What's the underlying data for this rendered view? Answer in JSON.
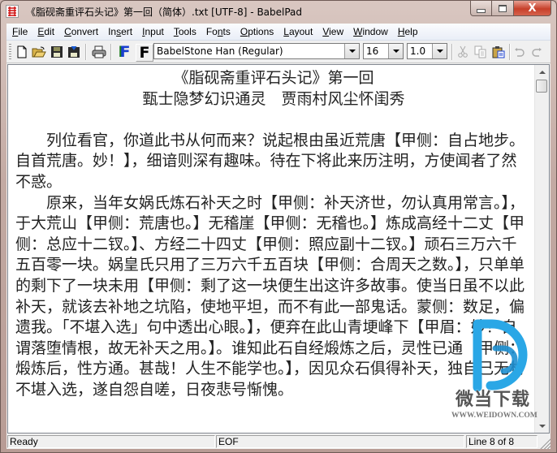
{
  "window": {
    "title": "《脂砚斋重评石头记》第一回（简体）.txt [UTF-8] - BabelPad",
    "app_icon": "babelpad-icon",
    "controls": {
      "minimize_glyph": "–",
      "maximize_glyph": "□",
      "close_glyph": "X"
    }
  },
  "menubar": {
    "items": [
      {
        "label": "File",
        "mnemonic": "F"
      },
      {
        "label": "Edit",
        "mnemonic": "E"
      },
      {
        "label": "Convert",
        "mnemonic": "C"
      },
      {
        "label": "Insert",
        "mnemonic": "s"
      },
      {
        "label": "Input",
        "mnemonic": "I"
      },
      {
        "label": "Tools",
        "mnemonic": "T"
      },
      {
        "label": "Fonts",
        "mnemonic": "n"
      },
      {
        "label": "Options",
        "mnemonic": "O"
      },
      {
        "label": "Layout",
        "mnemonic": "L"
      },
      {
        "label": "View",
        "mnemonic": "V"
      },
      {
        "label": "Window",
        "mnemonic": "W"
      },
      {
        "label": "Help",
        "mnemonic": "H"
      }
    ]
  },
  "toolbar": {
    "buttons": [
      "new-file",
      "open-folder",
      "save",
      "save-all",
      "print",
      "font-color-f",
      "font-bold-f",
      "cut",
      "copy",
      "paste",
      "undo",
      "redo"
    ],
    "font_name": "BabelStone Han (Regular)",
    "font_size": "16",
    "line_spacing": "1.0",
    "font_color_accent": "#1a3fd0",
    "font_color_secondary": "#1a7a1a"
  },
  "document": {
    "heading_lines": [
      "《脂砚斋重评石头记》第一回",
      "甄士隐梦幻识通灵　贾雨村风尘怀闺秀"
    ],
    "paragraphs": [
      "列位看官，你道此书从何而来？说起根由虽近荒唐【甲侧：自占地步。自首荒唐。妙！】，细谙则深有趣味。待在下将此来历注明，方使闻者了然不惑。",
      "原来，当年女娲氏炼石补天之时【甲侧：补天济世，勿认真用常言。】，于大荒山【甲侧：荒唐也。】无稽崖【甲侧：无稽也。】炼成高经十二丈【甲侧：总应十二钗。】、方经二十四丈【甲侧：照应副十二钗。】顽石三万六千五百零一块。娲皇氏只用了三万六千五百块【甲侧：合周天之数。】，只单单的剩下了一块未用【甲侧：剩了这一块便生出这许多故事。使当日虽不以此补天，就该去补地之坑陷，使地平坦，而不有此一部鬼话。蒙侧：数足，偏遗我。「不堪入选」句中透出心眼。】，便弃在此山青埂峰下【甲眉：妙！自谓落堕情根，故无补天之用。】。谁知此石自经煅炼之后，灵性已通【甲侧：煅炼后，性方通。甚哉！人生不能学也。】，因见众石俱得补天，独自己无材不堪入选，遂自怨自嗟，日夜悲号惭愧。"
    ]
  },
  "statusbar": {
    "status": "Ready",
    "position": "EOF",
    "line_info": "Line 8 of 8"
  },
  "watermark": {
    "brand_cn": "微当下载",
    "url": "WWW.WEIDOWN.COM",
    "color": "#2aa7e6"
  }
}
